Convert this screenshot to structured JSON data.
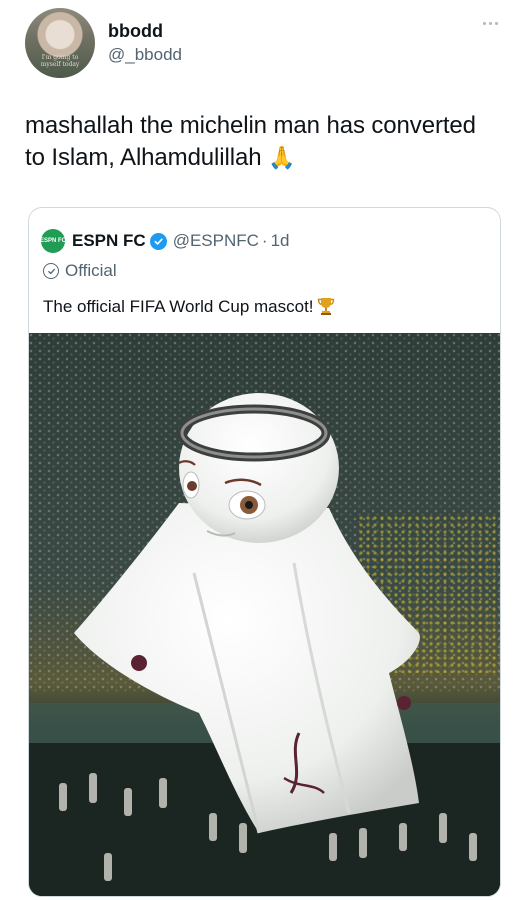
{
  "tweet": {
    "author": {
      "display_name": "bbodd",
      "handle": "@_bbodd",
      "avatar_caption": "I'm going to myself today"
    },
    "text": "mashallah the michelin man has converted to Islam, Alhamdulillah",
    "emoji": "🙏",
    "more_icon": "ellipsis-icon"
  },
  "quote": {
    "logo_text": "ESPN FC",
    "name": "ESPN FC",
    "handle": "@ESPNFC",
    "separator": "·",
    "time": "1d",
    "label": "Official",
    "text": "The official FIFA World Cup mascot!",
    "emoji_icon": "trophy-icon",
    "verified_icon": "verified-badge-icon",
    "label_icon": "check-circle-icon"
  },
  "colors": {
    "text": "#0f1419",
    "secondary": "#536471",
    "border": "#cfd9de",
    "verified": "#1d9bf0",
    "espn_green": "#1f9d55"
  }
}
